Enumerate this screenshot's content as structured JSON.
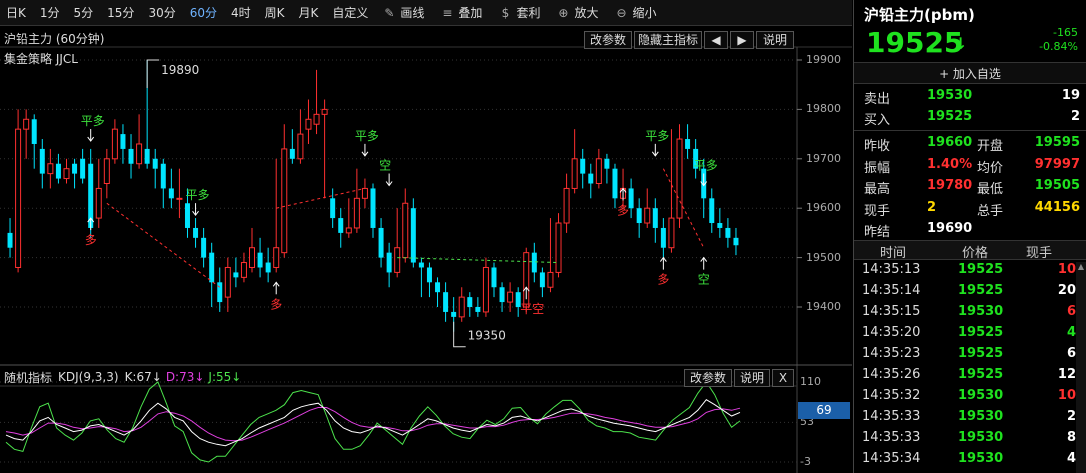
{
  "toolbar": {
    "periods": [
      "日K",
      "1分",
      "5分",
      "15分",
      "30分",
      "60分",
      "4时",
      "周K",
      "月K",
      "自定义"
    ],
    "active_period": "60分",
    "tools": [
      {
        "label": "画线",
        "icon": "pencil-icon"
      },
      {
        "label": "叠加",
        "icon": "stack-icon"
      },
      {
        "label": "套利",
        "icon": "money-bag-icon"
      },
      {
        "label": "放大",
        "icon": "zoom-in-icon"
      },
      {
        "label": "缩小",
        "icon": "zoom-out-icon"
      }
    ],
    "collapse": ">"
  },
  "chart": {
    "title": "沪铅主力 (60分钟)",
    "strategy": "集金策略 JJCL",
    "buttons": {
      "params": "改参数",
      "hide": "隐藏主指标",
      "left": "◀",
      "right": "▶",
      "help": "说明"
    },
    "price_axis": [
      "19900",
      "19800",
      "19700",
      "19600",
      "19500",
      "19400"
    ],
    "high_label": "19890",
    "low_label": "19350",
    "signals": [
      {
        "text": "平多",
        "color": "#3de23d"
      },
      {
        "text": "多",
        "color": "#ff3030"
      },
      {
        "text": "平多",
        "color": "#3de23d"
      },
      {
        "text": "多",
        "color": "#ff3030"
      },
      {
        "text": "平多",
        "color": "#3de23d"
      },
      {
        "text": "空",
        "color": "#3de23d"
      },
      {
        "text": "平空",
        "color": "#ff3030"
      },
      {
        "text": "多",
        "color": "#ff3030"
      },
      {
        "text": "平多",
        "color": "#3de23d"
      },
      {
        "text": "多",
        "color": "#ff3030"
      },
      {
        "text": "平多",
        "color": "#3de23d"
      },
      {
        "text": "空",
        "color": "#3de23d"
      }
    ]
  },
  "kdj": {
    "name": "随机指标",
    "params": "KDJ(9,3,3)",
    "k": "K:67↓",
    "d": "D:73↓",
    "j": "J:55↓",
    "buttons": {
      "params": "改参数",
      "help": "说明",
      "close": "X"
    },
    "axis": [
      "110",
      "53",
      "-3"
    ],
    "badge": "69"
  },
  "quote": {
    "name": "沪铅主力(pbm)",
    "price": "19525",
    "arrow": "↓",
    "change": "-165",
    "change_pct": "-0.84%",
    "add_watch": "+ 加入自选",
    "sell": {
      "label": "卖出",
      "price": "19530",
      "vol": "19"
    },
    "buy": {
      "label": "买入",
      "price": "19525",
      "vol": "2"
    },
    "stats": [
      {
        "l1": "昨收",
        "v1": "19660",
        "c1": "green",
        "l2": "开盘",
        "v2": "19595",
        "c2": "green"
      },
      {
        "l1": "振幅",
        "v1": "1.40%",
        "c1": "red",
        "l2": "均价",
        "v2": "97997",
        "c2": "red"
      },
      {
        "l1": "最高",
        "v1": "19780",
        "c1": "red",
        "l2": "最低",
        "v2": "19505",
        "c2": "green"
      },
      {
        "l1": "现手",
        "v1": "2",
        "c1": "yellow",
        "l2": "总手",
        "v2": "44156",
        "c2": "yellow"
      },
      {
        "l1": "昨结",
        "v1": "19690",
        "c1": "white",
        "l2": "",
        "v2": "",
        "c2": "white"
      }
    ],
    "ticks_header": {
      "time": "时间",
      "price": "价格",
      "vol": "现手"
    },
    "ticks": [
      {
        "time": "14:35:13",
        "price": "19525",
        "vol": "10",
        "vc": "red"
      },
      {
        "time": "14:35:14",
        "price": "19525",
        "vol": "20",
        "vc": "white"
      },
      {
        "time": "14:35:15",
        "price": "19530",
        "vol": "6",
        "vc": "red"
      },
      {
        "time": "14:35:20",
        "price": "19525",
        "vol": "4",
        "vc": "green"
      },
      {
        "time": "14:35:23",
        "price": "19525",
        "vol": "6",
        "vc": "white"
      },
      {
        "time": "14:35:26",
        "price": "19525",
        "vol": "12",
        "vc": "white"
      },
      {
        "time": "14:35:32",
        "price": "19530",
        "vol": "10",
        "vc": "red"
      },
      {
        "time": "14:35:33",
        "price": "19530",
        "vol": "2",
        "vc": "white"
      },
      {
        "time": "14:35:33",
        "price": "19530",
        "vol": "8",
        "vc": "white"
      },
      {
        "time": "14:35:34",
        "price": "19530",
        "vol": "4",
        "vc": "white"
      }
    ]
  },
  "colors": {
    "up": "#ff3030",
    "down": "#00e5ff",
    "green": "#1fe21f",
    "k_line": "#ffffff",
    "d_line": "#e040e0",
    "j_line": "#4ce24c"
  },
  "chart_data": {
    "type": "candlestick",
    "ylim": [
      19340,
      19920
    ],
    "candles": [
      [
        19550,
        19520,
        19580,
        19500
      ],
      [
        19480,
        19760,
        19800,
        19470
      ],
      [
        19760,
        19780,
        19800,
        19700
      ],
      [
        19780,
        19730,
        19790,
        19680
      ],
      [
        19720,
        19670,
        19740,
        19640
      ],
      [
        19670,
        19690,
        19720,
        19640
      ],
      [
        19690,
        19660,
        19710,
        19650
      ],
      [
        19660,
        19680,
        19700,
        19650
      ],
      [
        19690,
        19670,
        19700,
        19640
      ],
      [
        19700,
        19660,
        19720,
        19650
      ],
      [
        19690,
        19560,
        19720,
        19540
      ],
      [
        19580,
        19640,
        19700,
        19560
      ],
      [
        19650,
        19700,
        19720,
        19620
      ],
      [
        19700,
        19760,
        19780,
        19690
      ],
      [
        19750,
        19720,
        19770,
        19690
      ],
      [
        19720,
        19690,
        19750,
        19660
      ],
      [
        19690,
        19730,
        19790,
        19680
      ],
      [
        19720,
        19690,
        19900,
        19680
      ],
      [
        19700,
        19680,
        19720,
        19640
      ],
      [
        19690,
        19640,
        19700,
        19600
      ],
      [
        19640,
        19620,
        19680,
        19600
      ],
      [
        19620,
        19620,
        19680,
        19580
      ],
      [
        19610,
        19560,
        19640,
        19540
      ],
      [
        19560,
        19540,
        19580,
        19520
      ],
      [
        19540,
        19500,
        19560,
        19480
      ],
      [
        19510,
        19450,
        19530,
        19400
      ],
      [
        19450,
        19410,
        19480,
        19390
      ],
      [
        19420,
        19480,
        19500,
        19390
      ],
      [
        19470,
        19460,
        19500,
        19440
      ],
      [
        19460,
        19490,
        19510,
        19450
      ],
      [
        19480,
        19520,
        19560,
        19470
      ],
      [
        19510,
        19480,
        19540,
        19460
      ],
      [
        19490,
        19470,
        19520,
        19450
      ],
      [
        19480,
        19520,
        19700,
        19470
      ],
      [
        19510,
        19720,
        19770,
        19500
      ],
      [
        19720,
        19700,
        19760,
        19690
      ],
      [
        19700,
        19750,
        19800,
        19690
      ],
      [
        19760,
        19780,
        19820,
        19730
      ],
      [
        19770,
        19790,
        19880,
        19750
      ],
      [
        19790,
        19800,
        19820,
        19620
      ],
      [
        19620,
        19580,
        19640,
        19560
      ],
      [
        19580,
        19550,
        19600,
        19520
      ],
      [
        19550,
        19560,
        19620,
        19540
      ],
      [
        19560,
        19620,
        19680,
        19550
      ],
      [
        19620,
        19640,
        19660,
        19600
      ],
      [
        19640,
        19560,
        19650,
        19540
      ],
      [
        19560,
        19500,
        19580,
        19480
      ],
      [
        19510,
        19470,
        19530,
        19440
      ],
      [
        19470,
        19520,
        19600,
        19460
      ],
      [
        19500,
        19610,
        19640,
        19490
      ],
      [
        19600,
        19490,
        19620,
        19480
      ],
      [
        19490,
        19480,
        19500,
        19420
      ],
      [
        19480,
        19450,
        19490,
        19420
      ],
      [
        19450,
        19430,
        19460,
        19400
      ],
      [
        19430,
        19390,
        19450,
        19370
      ],
      [
        19390,
        19380,
        19420,
        19350
      ],
      [
        19380,
        19420,
        19440,
        19370
      ],
      [
        19420,
        19400,
        19430,
        19380
      ],
      [
        19400,
        19390,
        19420,
        19380
      ],
      [
        19390,
        19480,
        19500,
        19380
      ],
      [
        19480,
        19440,
        19490,
        19420
      ],
      [
        19440,
        19410,
        19450,
        19390
      ],
      [
        19410,
        19430,
        19450,
        19390
      ],
      [
        19430,
        19400,
        19440,
        19380
      ],
      [
        19400,
        19510,
        19520,
        19390
      ],
      [
        19510,
        19470,
        19530,
        19450
      ],
      [
        19470,
        19440,
        19480,
        19420
      ],
      [
        19440,
        19470,
        19580,
        19430
      ],
      [
        19470,
        19570,
        19590,
        19460
      ],
      [
        19570,
        19640,
        19670,
        19550
      ],
      [
        19640,
        19700,
        19760,
        19630
      ],
      [
        19700,
        19670,
        19720,
        19640
      ],
      [
        19670,
        19650,
        19690,
        19620
      ],
      [
        19650,
        19700,
        19720,
        19640
      ],
      [
        19700,
        19680,
        19710,
        19650
      ],
      [
        19680,
        19620,
        19690,
        19600
      ],
      [
        19620,
        19640,
        19680,
        19600
      ],
      [
        19640,
        19600,
        19660,
        19580
      ],
      [
        19600,
        19570,
        19620,
        19540
      ],
      [
        19570,
        19600,
        19640,
        19560
      ],
      [
        19600,
        19560,
        19620,
        19530
      ],
      [
        19560,
        19520,
        19580,
        19500
      ],
      [
        19520,
        19580,
        19760,
        19510
      ],
      [
        19580,
        19740,
        19770,
        19560
      ],
      [
        19740,
        19720,
        19770,
        19700
      ],
      [
        19720,
        19680,
        19740,
        19660
      ],
      [
        19680,
        19620,
        19700,
        19580
      ],
      [
        19620,
        19570,
        19640,
        19550
      ],
      [
        19570,
        19560,
        19600,
        19540
      ],
      [
        19560,
        19540,
        19580,
        19520
      ],
      [
        19540,
        19525,
        19560,
        19505
      ]
    ],
    "kdj": {
      "k": [
        35,
        30,
        28,
        40,
        55,
        60,
        50,
        45,
        40,
        42,
        48,
        50,
        45,
        40,
        35,
        42,
        55,
        70,
        80,
        72,
        60,
        55,
        40,
        30,
        25,
        22,
        20,
        25,
        30,
        38,
        45,
        50,
        55,
        60,
        70,
        75,
        78,
        80,
        70,
        55,
        45,
        40,
        38,
        42,
        48,
        45,
        40,
        35,
        42,
        50,
        58,
        55,
        50,
        45,
        42,
        40,
        45,
        50,
        48,
        52,
        60,
        62,
        58,
        55,
        60,
        65,
        70,
        72,
        68,
        62,
        58,
        55,
        52,
        50,
        48,
        45,
        42,
        40,
        45,
        50,
        55,
        60,
        70,
        85,
        78,
        70,
        62,
        67
      ],
      "d": [
        40,
        38,
        35,
        38,
        45,
        52,
        52,
        50,
        46,
        44,
        45,
        47,
        46,
        44,
        40,
        41,
        46,
        55,
        65,
        68,
        66,
        62,
        55,
        46,
        38,
        32,
        28,
        27,
        28,
        32,
        37,
        42,
        47,
        52,
        58,
        64,
        70,
        74,
        74,
        68,
        60,
        53,
        48,
        46,
        46,
        46,
        44,
        41,
        41,
        44,
        49,
        51,
        51,
        49,
        47,
        45,
        45,
        47,
        47,
        49,
        53,
        56,
        57,
        57,
        58,
        60,
        63,
        66,
        66,
        65,
        63,
        60,
        58,
        55,
        53,
        51,
        48,
        46,
        46,
        47,
        50,
        53,
        58,
        67,
        71,
        72,
        70,
        73
      ],
      "j": [
        25,
        15,
        12,
        45,
        75,
        80,
        45,
        35,
        28,
        38,
        55,
        58,
        42,
        30,
        25,
        45,
        75,
        100,
        110,
        80,
        48,
        40,
        10,
        0,
        -3,
        5,
        5,
        20,
        35,
        50,
        60,
        65,
        70,
        78,
        95,
        98,
        95,
        92,
        62,
        30,
        15,
        15,
        20,
        35,
        52,
        42,
        32,
        22,
        45,
        62,
        75,
        63,
        48,
        37,
        32,
        30,
        45,
        56,
        50,
        58,
        73,
        74,
        60,
        51,
        65,
        75,
        84,
        84,
        72,
        56,
        48,
        45,
        40,
        40,
        38,
        32,
        30,
        28,
        43,
        56,
        65,
        74,
        94,
        110,
        92,
        66,
        46,
        55
      ]
    }
  }
}
